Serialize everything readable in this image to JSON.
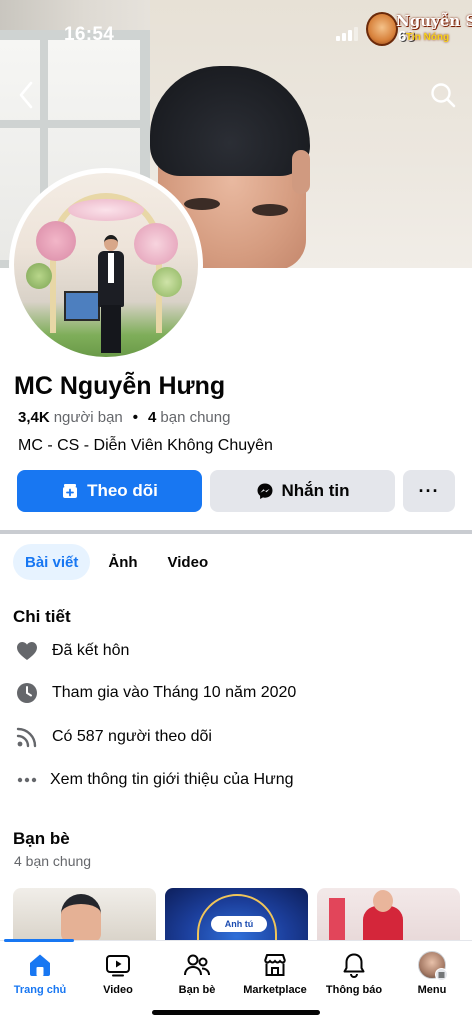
{
  "status_bar": {
    "time": "16:54"
  },
  "watermark": {
    "title": "Nguyễn Sin",
    "number": "68",
    "subtitle": "Tin Nóng"
  },
  "profile": {
    "name": "MC Nguyễn Hưng",
    "friends_count": "3,4K",
    "friends_label": "người bạn",
    "mutual_count": "4",
    "mutual_label": "bạn chung",
    "bio": "MC - CS - Diễn Viên Không Chuyên"
  },
  "actions": {
    "follow": "Theo dõi",
    "message": "Nhắn tin",
    "more": "···"
  },
  "tabs": [
    {
      "label": "Bài viết",
      "active": true
    },
    {
      "label": "Ảnh",
      "active": false
    },
    {
      "label": "Video",
      "active": false
    }
  ],
  "details": {
    "title": "Chi tiết",
    "married": "Đã kết hôn",
    "joined": "Tham gia vào Tháng 10 năm 2020",
    "followers": "Có 587 người theo dõi",
    "about": "Xem thông tin giới thiệu của Hưng"
  },
  "friends": {
    "title": "Bạn bè",
    "subtitle": "4 bạn chung",
    "card_badge": "Anh tú"
  },
  "nav": [
    {
      "label": "Trang chủ",
      "icon": "home-icon",
      "active": true
    },
    {
      "label": "Video",
      "icon": "video-icon",
      "active": false
    },
    {
      "label": "Bạn bè",
      "icon": "friends-icon",
      "active": false
    },
    {
      "label": "Marketplace",
      "icon": "marketplace-icon",
      "active": false
    },
    {
      "label": "Thông báo",
      "icon": "bell-icon",
      "active": false
    },
    {
      "label": "Menu",
      "icon": "menu-avatar",
      "active": false
    }
  ],
  "colors": {
    "accent": "#1877f2",
    "secondary_button": "#e4e6eb",
    "muted_text": "#65676b"
  }
}
